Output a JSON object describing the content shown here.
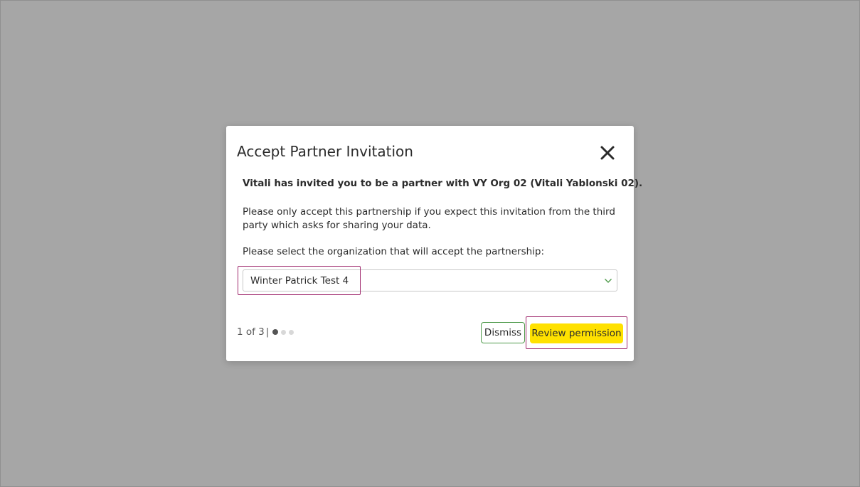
{
  "modal": {
    "title": "Accept Partner Invitation",
    "invite_text": "Vitali has invited you to be a partner with VY Org 02 (Vitali Yablonski 02).",
    "notice_text": "Please only accept this partnership if you expect this invitation from the third party which asks for sharing your data.",
    "select_label": "Please select the organization that will accept the partnership:",
    "organization_select": {
      "selected_value": "Winter Patrick Test 4"
    },
    "pager": {
      "text": "1 of 3",
      "separator": "|",
      "total_steps": 3,
      "current_step": 1
    },
    "buttons": {
      "dismiss_label": "Dismiss",
      "review_label": "Review permission"
    },
    "icons": {
      "close": "close-icon",
      "chevron": "chevron-down-icon"
    }
  },
  "colors": {
    "overlay": "#a6a6a6",
    "primary_button": "#ffe100",
    "secondary_border": "#4e9a4a",
    "chevron": "#4e9a4a",
    "highlight": "#a02a6e"
  }
}
